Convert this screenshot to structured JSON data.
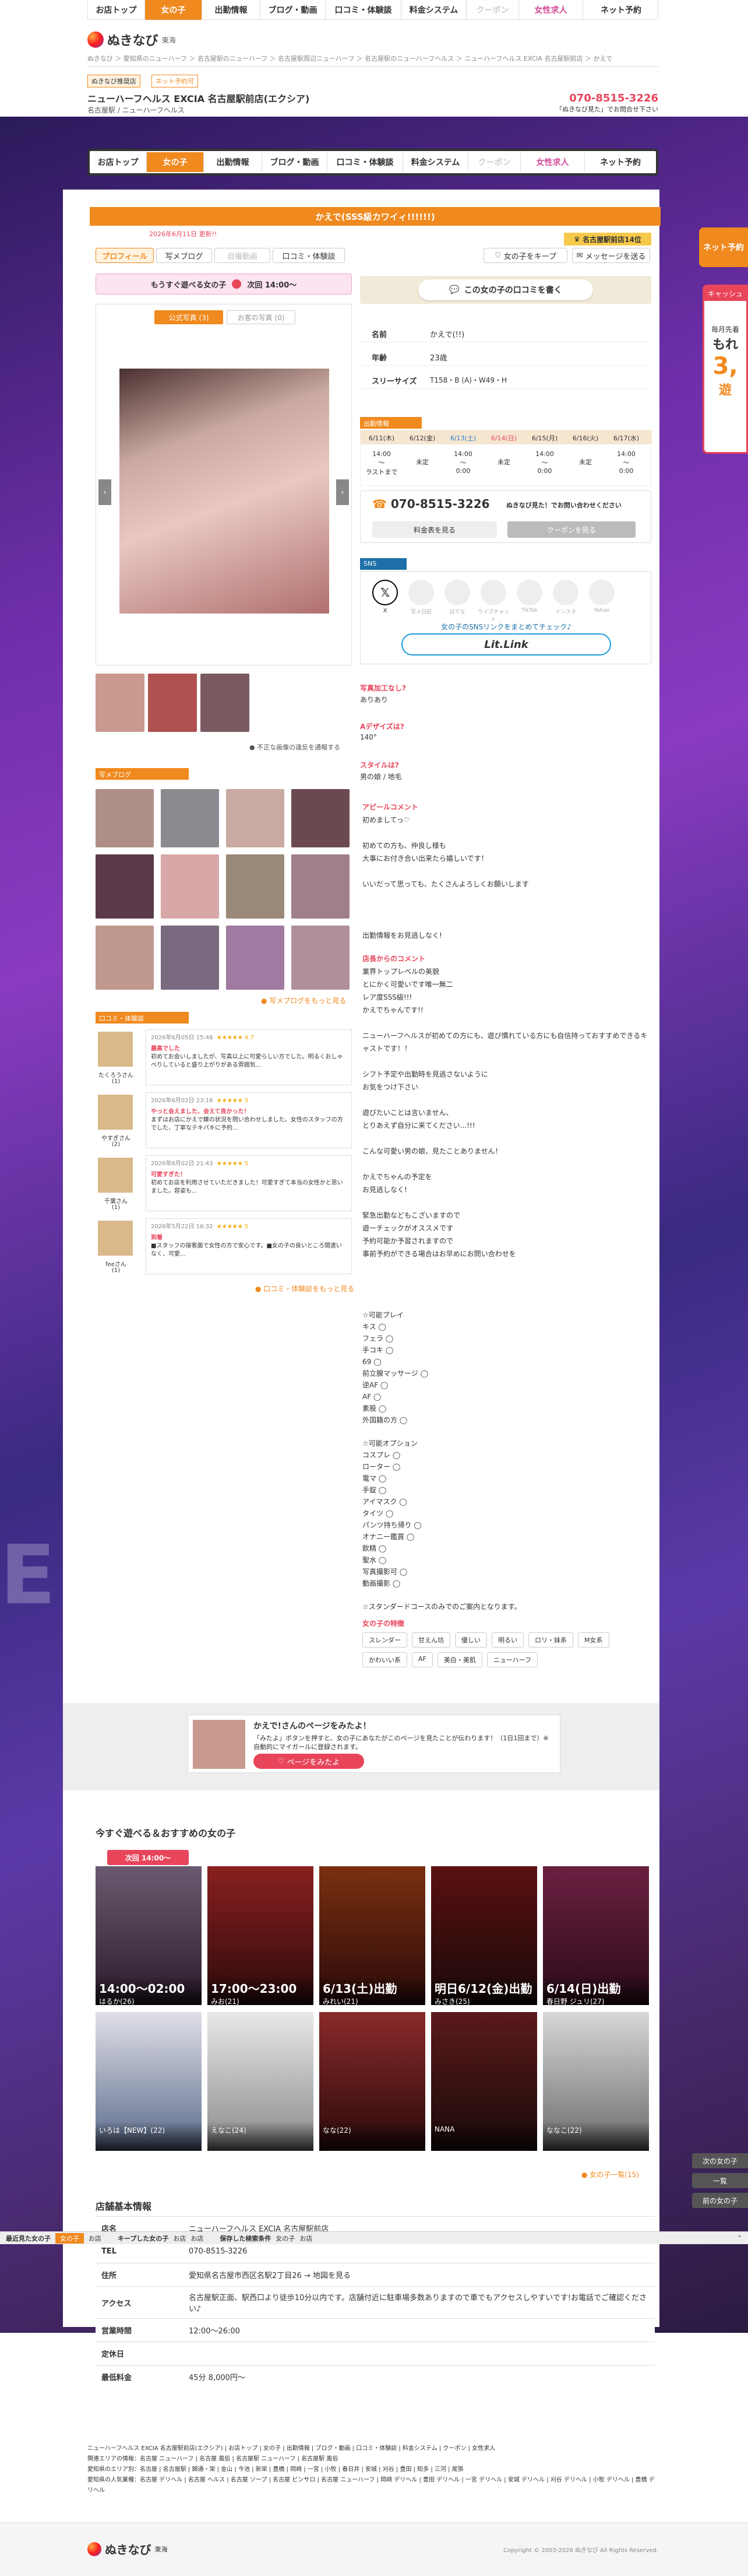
{
  "top_nav": {
    "items": [
      "お店トップ",
      "女の子",
      "出勤情報",
      "ブログ・動画",
      "口コミ・体験談",
      "料金システム",
      "クーポン",
      "女性求人",
      "ネット予約"
    ],
    "active_index": 1
  },
  "logo": {
    "text": "ぬきなび",
    "region": "東海"
  },
  "breadcrumb": [
    "ぬきなび",
    "愛知県のニューハーフ",
    "名古屋駅のニューハーフ",
    "名古屋駅周辺ニューハーフ",
    "名古屋駅のニューハーフヘルス",
    "ニューハーフヘルス EXCIA 名古屋駅前店",
    "かえで"
  ],
  "shop": {
    "badge1": "ぬきなび推奨店",
    "badge2": "ネット予約可",
    "name": "ニューハーフヘルス EXCIA 名古屋駅前店(エクシア)",
    "area": "名古屋駅 / ニューハーフヘルス",
    "phone": "070-8515-3226",
    "phone_note": "「ぬきなび見た」でお問合せ下さい"
  },
  "profile": {
    "title": "かえで(SSS級カワイィ!!!!!!)",
    "date": "2026年6月11日 更新!!",
    "rank_badge": "名古屋駅前店14位",
    "tabs": [
      "プロフィール",
      "写メブログ",
      "自撮動画",
      "口コミ・体験談"
    ],
    "fav": "女の子をキープ",
    "msg": "メッセージを送る",
    "available": "もうすぐ遊べる女の子",
    "available_time": "次回 14:00〜",
    "photo_tabs": [
      "公式写真 (3)",
      "お客の写真 (0)"
    ],
    "photo_note": "不正な画像の違反を通報する"
  },
  "review_btn": "この女の子の口コミを書く",
  "stats": [
    {
      "label": "名前",
      "value": "かえで(!!)"
    },
    {
      "label": "年齢",
      "value": "23歳"
    },
    {
      "label": "スリーサイズ",
      "value": "T158・B (A)・W49・H"
    }
  ],
  "schedule": {
    "title": "出勤情報",
    "days": [
      "6/11(木)",
      "6/12(金)",
      "6/13(土)",
      "6/14(日)",
      "6/15(月)",
      "6/16(火)",
      "6/17(水)"
    ],
    "times": [
      "14:00\n〜\nラストまで",
      "未定",
      "14:00\n〜\n0:00",
      "未定",
      "14:00\n〜\n0:00",
      "未定",
      "14:00\n〜\n0:00"
    ]
  },
  "contact": {
    "phone": "070-8515-3226",
    "note": "ぬきなび見た！でお問い合わせください",
    "btn1": "料金表を見る",
    "btn2": "クーポンを見る"
  },
  "sns": {
    "title": "SNS",
    "items": [
      "X",
      "写メ日記",
      "はてな",
      "ライブチャット",
      "TikTok",
      "インスタ",
      "Yahoo"
    ],
    "link_text": "女の子のSNSリンクをまとめてチェック♪",
    "lit": "Lit.Link"
  },
  "profile_qa": [
    {
      "q": "写真加工なし?",
      "a": "ありあり"
    },
    {
      "q": "Aデザイズは?",
      "a": "140°"
    },
    {
      "q": "スタイルは?",
      "a": "男の娘 / 地毛"
    }
  ],
  "appeal_title": "アピールコメント",
  "appeal_text": [
    "初めましてっ♡",
    "初めての方も、仲良し様も",
    "大事にお付き合い出来たら嬉しいです！",
    "いいだって思っても、たくさんよろしくお願いします",
    "",
    "出勤情報をお見逃しなく!"
  ],
  "shop_comment_title": "店長からのコメント",
  "shop_comment": [
    "業界トップレベルの美貌",
    "とにかく可愛いです唯一無二",
    "レア度SSS級!!!",
    "かえでちゃんです!!",
    "",
    "ニューハーフヘルスが初めての方にも、遊び慣れている方にも自信持っておすすめできるキャストです！！",
    "",
    "シフト予定や出勤時を見逃さないように",
    "お気をつけ下さい",
    "",
    "遊びたいことは言いません、",
    "とりあえず自分に来てください...!!!",
    "",
    "こんな可愛い男の娘、見たことありません！",
    "",
    "かえでちゃんの予定を",
    "お見逃しなく!",
    "",
    "緊急出勤などもこざいますので",
    "遊ーチェックがオススメです",
    "予約可能か予習されますので",
    "事前予約ができる場合はお早めにお問い合わせを"
  ],
  "options_title1": "☆可能プレイ",
  "options1": [
    "キス ◯",
    "フェラ ◯",
    "手コキ ◯",
    "69 ◯",
    "前立腺マッサージ ◯",
    "逆AF ◯",
    "AF ◯",
    "素股 ◯",
    "外国籍の方 ◯"
  ],
  "options_title2": "☆可能オプション",
  "options2": [
    "コスプレ ◯",
    "ローター ◯",
    "電マ ◯",
    "手錠 ◯",
    "アイマスク ◯",
    "タイツ ◯",
    "パンツ持ち帰り ◯",
    "オナニー鑑賞 ◯",
    "飲精 ◯",
    "聖水 ◯",
    "写真撮影可 ◯",
    "動画撮影 ◯"
  ],
  "standard_note": "☆スタンダードコースのみでのご案内となります。",
  "tags_title": "女の子の特徴",
  "tags": [
    "スレンダー",
    "甘えん坊",
    "優しい",
    "明るい",
    "ロリ・妹系",
    "M女系",
    "かわいい系",
    "AF",
    "美白・美肌",
    "ニューハーフ"
  ],
  "blog": {
    "title": "写メブログ",
    "more": "写メブログをもっと見る"
  },
  "reviews": {
    "title": "口コミ・体験談",
    "more": "口コミ・体験談をもっと見る",
    "items": [
      {
        "user": "たくろうさん",
        "count": "(1)",
        "date": "2026年6月05日 15:48",
        "stars": "★★★★★ 4.7",
        "title": "最高でした",
        "text": "初めてお会いしましたが、写真以上に可愛らしい方でした。明るくおしゃべりしていると盛り上がりがある雰囲気..."
      },
      {
        "user": "やすぎさん",
        "count": "(2)",
        "date": "2026年6月02日 23:16",
        "stars": "★★★★★ 5",
        "title": "やっと会えました、会えて良かった！",
        "text": "まずはお店にかえで嬢の状況を問い合わせしました。女性のスタッフの方でした、丁寧なテキパキに予約..."
      },
      {
        "user": "千葉さん",
        "count": "(1)",
        "date": "2026年6月02日 21:43",
        "stars": "★★★★★ 5",
        "title": "可愛すぎた！",
        "text": "初めてお店を利用させていただきました！可愛すぎて本当の女性かと思いました。容姿も..."
      },
      {
        "user": "feeさん",
        "count": "(1)",
        "date": "2026年5月22日 16:32",
        "stars": "★★★★★ 5",
        "title": "到着",
        "text": "■スタッフの接客面で女性の方で安心です。■女の子の良いところ間違いなく、可愛..."
      }
    ]
  },
  "share": {
    "title": "かえで!さんのページをみたよ！",
    "text": "「みたよ」ボタンを押すと、女の子にあなたがこのページを見たことが伝わります！（1日1回まで）※自動的にマイガールに登録されます。",
    "btn": "ページをみたよ"
  },
  "recommend": {
    "title": "今すぐ遊べる＆おすすめの女の子",
    "badge": "次回 14:00〜",
    "cards": [
      {
        "t": "14:00〜02:00",
        "n": "はるか(26)"
      },
      {
        "t": "17:00〜23:00",
        "n": "みお(21)"
      },
      {
        "t": "6/13(土)出勤",
        "n": "みれい(21)"
      },
      {
        "t": "明日6/12(金)出勤",
        "n": "みさき(25)"
      },
      {
        "t": "6/14(日)出勤",
        "n": "春日野 ジュリ(27)"
      },
      {
        "t": "",
        "n": "いろは【NEW】(22)"
      },
      {
        "t": "",
        "n": "えなこ(24)"
      },
      {
        "t": "",
        "n": "なな(22)"
      },
      {
        "t": "",
        "n": "NANA"
      },
      {
        "t": "",
        "n": "ななこ(22)"
      }
    ],
    "more": "女の子一覧(15)"
  },
  "basic_info": {
    "title": "店舗基本情報",
    "rows": [
      {
        "k": "店名",
        "v": "ニューハーフヘルス EXCIA 名古屋駅前店"
      },
      {
        "k": "TEL",
        "v": "070-8515-3226"
      },
      {
        "k": "住所",
        "v": "愛知県名古屋市西区名駅2丁目26 → 地図を見る"
      },
      {
        "k": "アクセス",
        "v": "名古屋駅正面、駅西口より徒歩10分以内です。店舗付近に駐車場多数ありますので車でもアクセスしやすいです!お電話でご確認ください♪"
      },
      {
        "k": "営業時間",
        "v": "12:00〜26:00"
      },
      {
        "k": "定休日",
        "v": ""
      },
      {
        "k": "最低料金",
        "v": "45分 8,000円〜"
      }
    ]
  },
  "bottom_bar": {
    "items": [
      "最近見た女の子",
      "女の子",
      "お店",
      "キープした女の子",
      "お店",
      "保存した検索条件",
      "女の子",
      "お店"
    ]
  },
  "side_buttons": [
    "ネット予約",
    "キャッシュ",
    "次の女の子",
    "一覧",
    "前の女の子"
  ],
  "side_banner": {
    "l1": "毎月先着",
    "l2": "もれ",
    "l3": "3,",
    "l4": "遊"
  },
  "footer": {
    "line1": "ニューハーフヘルス EXCIA 名古屋駅前店(エクシア) | お店トップ | 女の子 | 出勤情報 | ブログ・動画 | 口コミ・体験談 | 料金システム | クーポン | 女性求人",
    "line2": "関連エリアの情報：名古屋 ニューハーフ | 名古屋 風俗 | 名古屋駅 ニューハーフ | 名古屋駅 風俗",
    "line3": "愛知県のエリア別：名古屋 | 名古屋駅 | 錦通・栄 | 金山 | 今池 | 新栄 | 豊橋 | 岡崎 | 一宮 | 小牧 | 春日井 | 安城 | 刈谷 | 豊田 | 知多 | 三河 | 尾張",
    "line4": "愛知県の人気業種：名古屋 デリヘル | 名古屋 ヘルス | 名古屋 ソープ | 名古屋 ピンサロ | 名古屋 ニューハーフ | 岡崎 デリヘル | 豊田 デリヘル | 一宮 デリヘル | 安城 デリヘル | 刈谷 デリヘル | 小牧 デリヘル | 豊橋 デリヘル",
    "copyright": "Copyright © 2003-2026 ぬきなび All Rights Reserved."
  },
  "colors": {
    "orange": "#f0891e",
    "pink": "#e8455b",
    "purple": "#6d2ea8"
  }
}
